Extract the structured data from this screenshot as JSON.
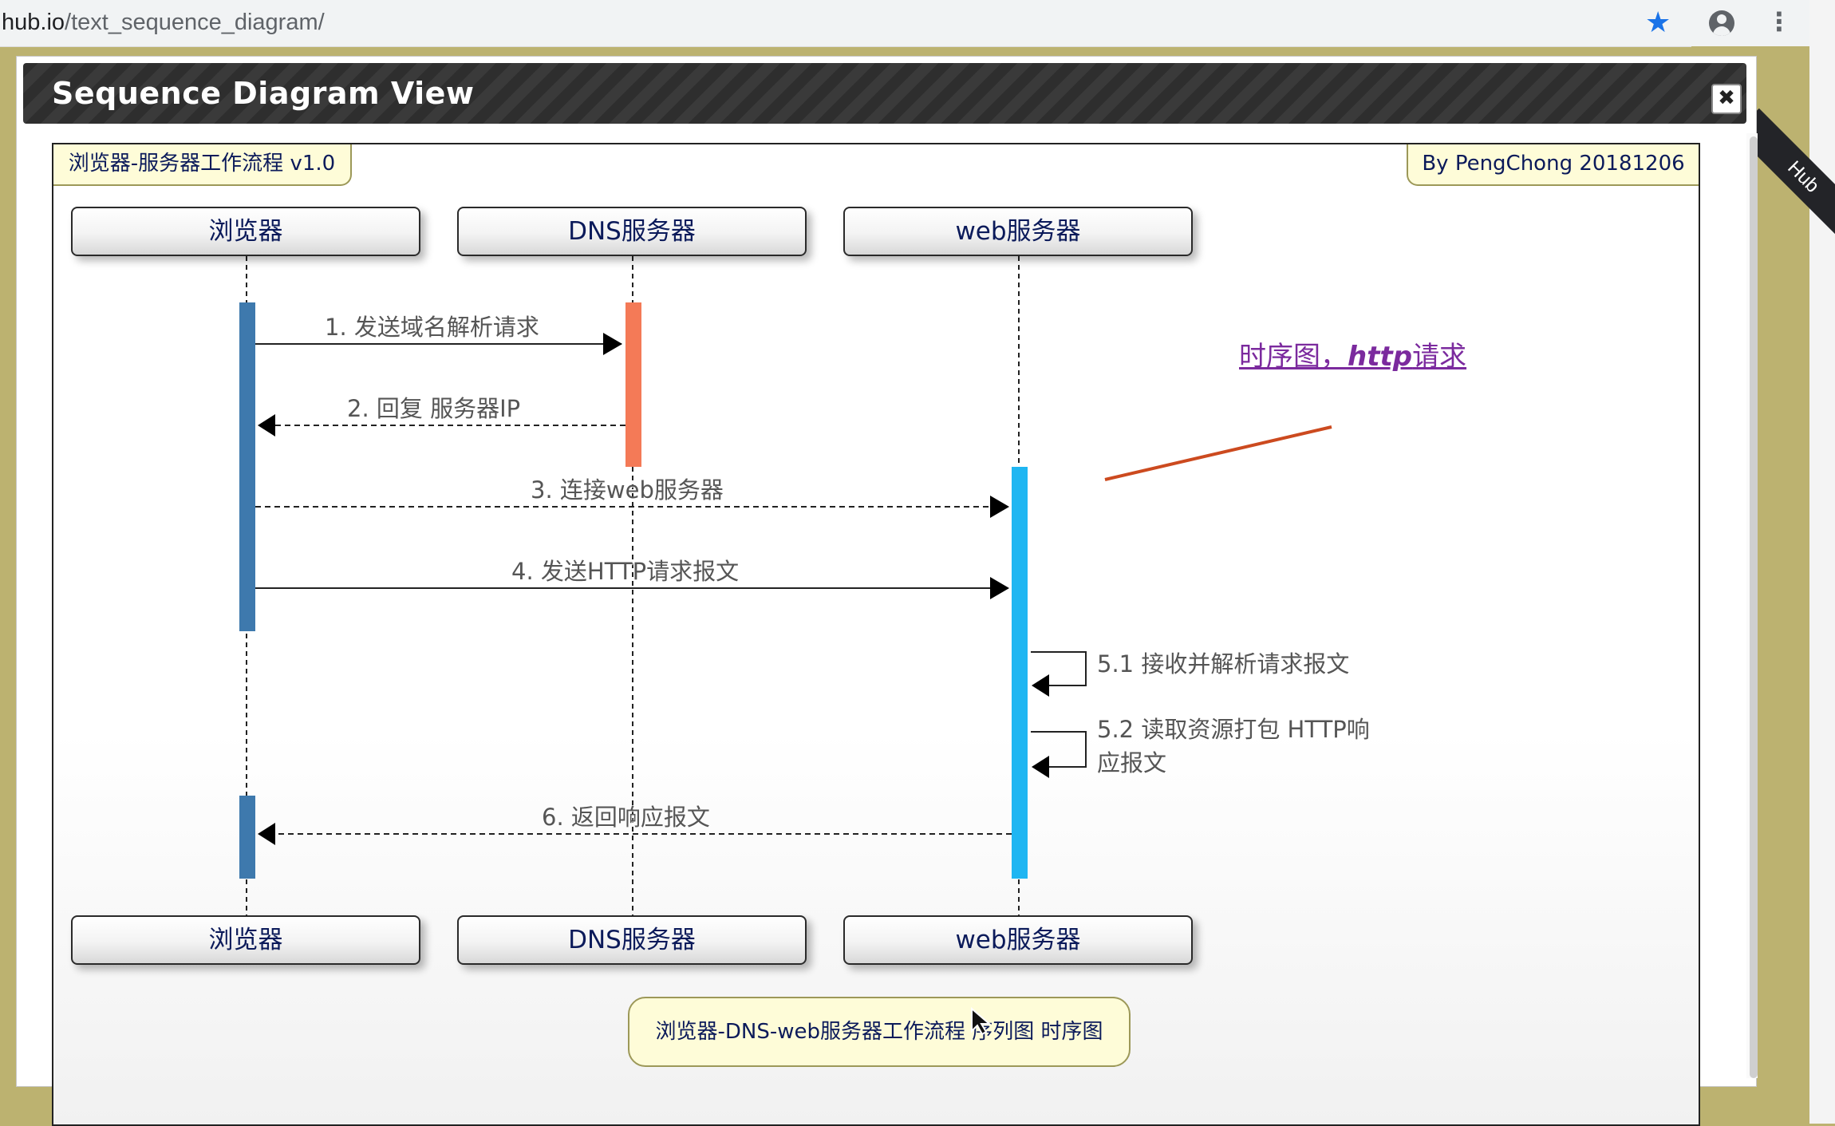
{
  "browser": {
    "url_host": "hub.io",
    "url_path": "/text_sequence_diagram/",
    "ribbon_text": "Hub"
  },
  "dialog": {
    "title": "Sequence Diagram View",
    "close_label": "✖"
  },
  "diagram": {
    "title_tag": "浏览器-服务器工作流程 v1.0",
    "author_tag": "By PengChong 20181206",
    "participants": [
      "浏览器",
      "DNS服务器",
      "web服务器"
    ],
    "messages": [
      {
        "label": "1. 发送域名解析请求"
      },
      {
        "label": "2. 回复 服务器IP"
      },
      {
        "label": "3. 连接web服务器"
      },
      {
        "label": "4. 发送HTTP请求报文"
      },
      {
        "label": "5.1 接收并解析请求报文"
      },
      {
        "label_line1": "5.2 读取资源打包 HTTP响",
        "label_line2": "应报文"
      },
      {
        "label": "6. 返回响应报文"
      }
    ],
    "annotation_text": "时序图，",
    "annotation_italic": "http",
    "annotation_suffix": "请求",
    "bottom_note": "浏览器-DNS-web服务器工作流程 序列图 时序图",
    "colors": {
      "browser_activation": "#3e79ad",
      "dns_activation": "#f47a57",
      "web_activation": "#1fb6f2",
      "annotation_line": "#cc4a1f"
    }
  }
}
